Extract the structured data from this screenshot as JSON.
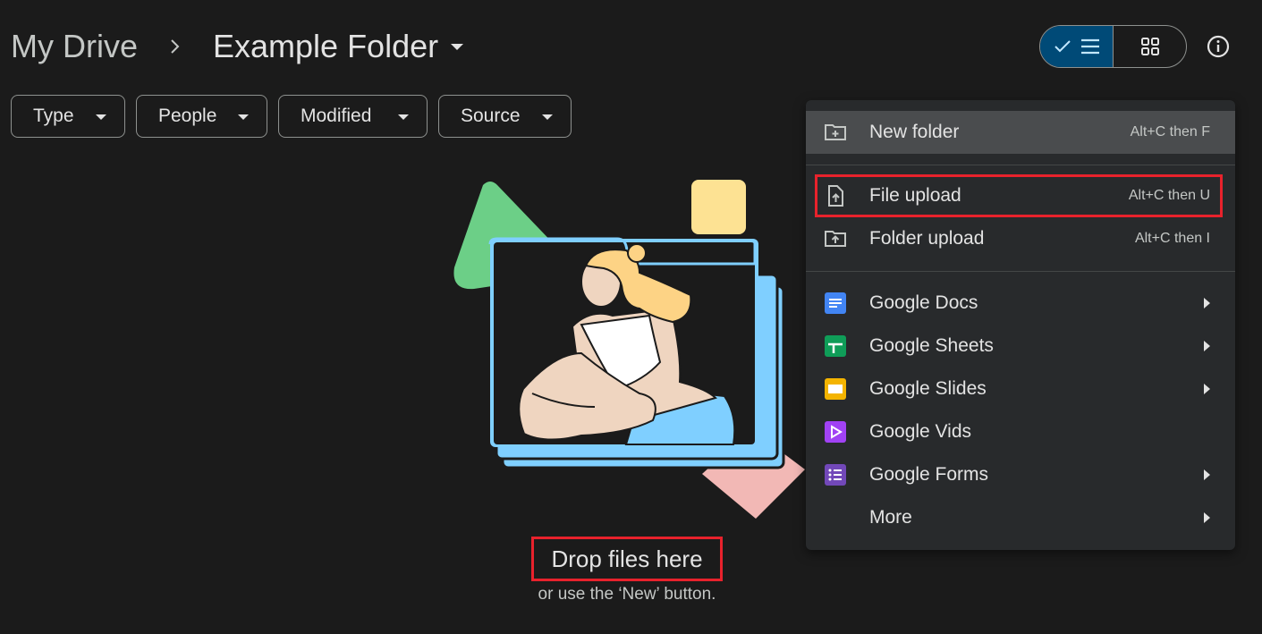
{
  "breadcrumb": {
    "root": "My Drive",
    "current": "Example Folder"
  },
  "filters": [
    {
      "label": "Type"
    },
    {
      "label": "People"
    },
    {
      "label": "Modified"
    },
    {
      "label": "Source"
    }
  ],
  "empty_state": {
    "title": "Drop files here",
    "subtitle": "or use the ‘New’ button."
  },
  "menu": {
    "items": [
      {
        "label": "New folder",
        "shortcut": "Alt+C then F",
        "icon": "new-folder-icon"
      },
      {
        "label": "File upload",
        "shortcut": "Alt+C then U",
        "icon": "file-upload-icon"
      },
      {
        "label": "Folder upload",
        "shortcut": "Alt+C then I",
        "icon": "folder-upload-icon"
      },
      {
        "label": "Google Docs",
        "icon": "google-docs-icon"
      },
      {
        "label": "Google Sheets",
        "icon": "google-sheets-icon"
      },
      {
        "label": "Google Slides",
        "icon": "google-slides-icon"
      },
      {
        "label": "Google Vids",
        "icon": "google-vids-icon"
      },
      {
        "label": "Google Forms",
        "icon": "google-forms-icon"
      },
      {
        "label": "More"
      }
    ]
  },
  "colors": {
    "background": "#1b1b1b",
    "menu_bg": "#282a2c",
    "highlight": "#e8222c",
    "accent": "#004a77",
    "docs": "#4285f4",
    "sheets": "#0f9d58",
    "slides": "#f4b400",
    "vids": "#a142f4",
    "forms": "#7248b9"
  }
}
